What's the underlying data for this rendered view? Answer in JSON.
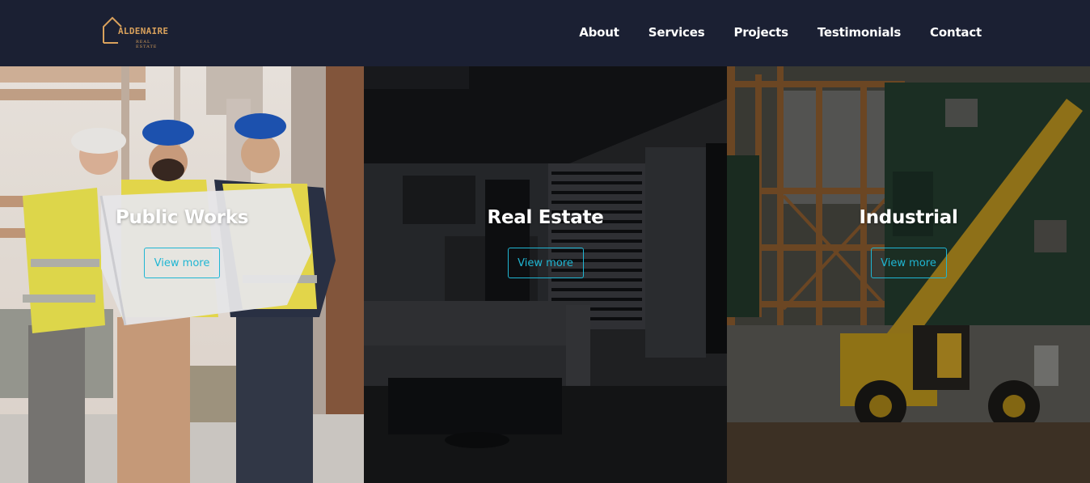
{
  "brand": {
    "name": "ALDENAIRE",
    "tagline": "REAL ESTATE",
    "accent_color": "#d9a15c"
  },
  "nav": {
    "items": [
      {
        "label": "About"
      },
      {
        "label": "Services"
      },
      {
        "label": "Projects"
      },
      {
        "label": "Testimonials"
      },
      {
        "label": "Contact"
      }
    ]
  },
  "panels": [
    {
      "title": "Public Works",
      "button_label": "View more",
      "image": "engineers-with-blueprint-photo"
    },
    {
      "title": "Real Estate",
      "button_label": "View more",
      "image": "dark-interior-living-room-photo"
    },
    {
      "title": "Industrial",
      "button_label": "View more",
      "image": "construction-site-telehandler-photo"
    }
  ],
  "colors": {
    "header_background": "#1b2033",
    "button_accent": "#1fb6d3",
    "title_text": "#ffffff"
  }
}
